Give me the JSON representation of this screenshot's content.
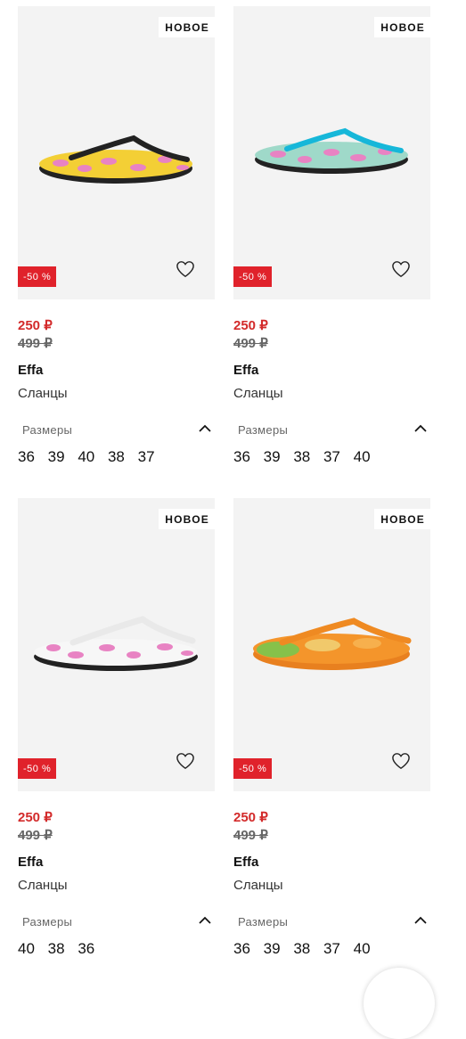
{
  "products": [
    {
      "badge_new": "НОВОЕ",
      "badge_sale": "-50 %",
      "price_new": "250 ₽",
      "price_old": "499 ₽",
      "brand": "Effa",
      "type": "Сланцы",
      "sizes_label": "Размеры",
      "sizes": [
        "36",
        "39",
        "40",
        "38",
        "37"
      ],
      "image": "flip-flop-yellow-pink-black-strap"
    },
    {
      "badge_new": "НОВОЕ",
      "badge_sale": "-50 %",
      "price_new": "250 ₽",
      "price_old": "499 ₽",
      "brand": "Effa",
      "type": "Сланцы",
      "sizes_label": "Размеры",
      "sizes": [
        "36",
        "39",
        "38",
        "37",
        "40"
      ],
      "image": "flip-flop-mint-pink-turquoise-strap"
    },
    {
      "badge_new": "НОВОЕ",
      "badge_sale": "-50 %",
      "price_new": "250 ₽",
      "price_old": "499 ₽",
      "brand": "Effa",
      "type": "Сланцы",
      "sizes_label": "Размеры",
      "sizes": [
        "40",
        "38",
        "36"
      ],
      "image": "flip-flop-white-pink-white-strap"
    },
    {
      "badge_new": "НОВОЕ",
      "badge_sale": "-50 %",
      "price_new": "250 ₽",
      "price_old": "499 ₽",
      "brand": "Effa",
      "type": "Сланцы",
      "sizes_label": "Размеры",
      "sizes": [
        "36",
        "39",
        "38",
        "37",
        "40"
      ],
      "image": "flip-flop-orange-print"
    }
  ],
  "colors": {
    "sale": "#e0222b",
    "price_new": "#d32b2b",
    "image_bg": "#f3f3f3"
  }
}
